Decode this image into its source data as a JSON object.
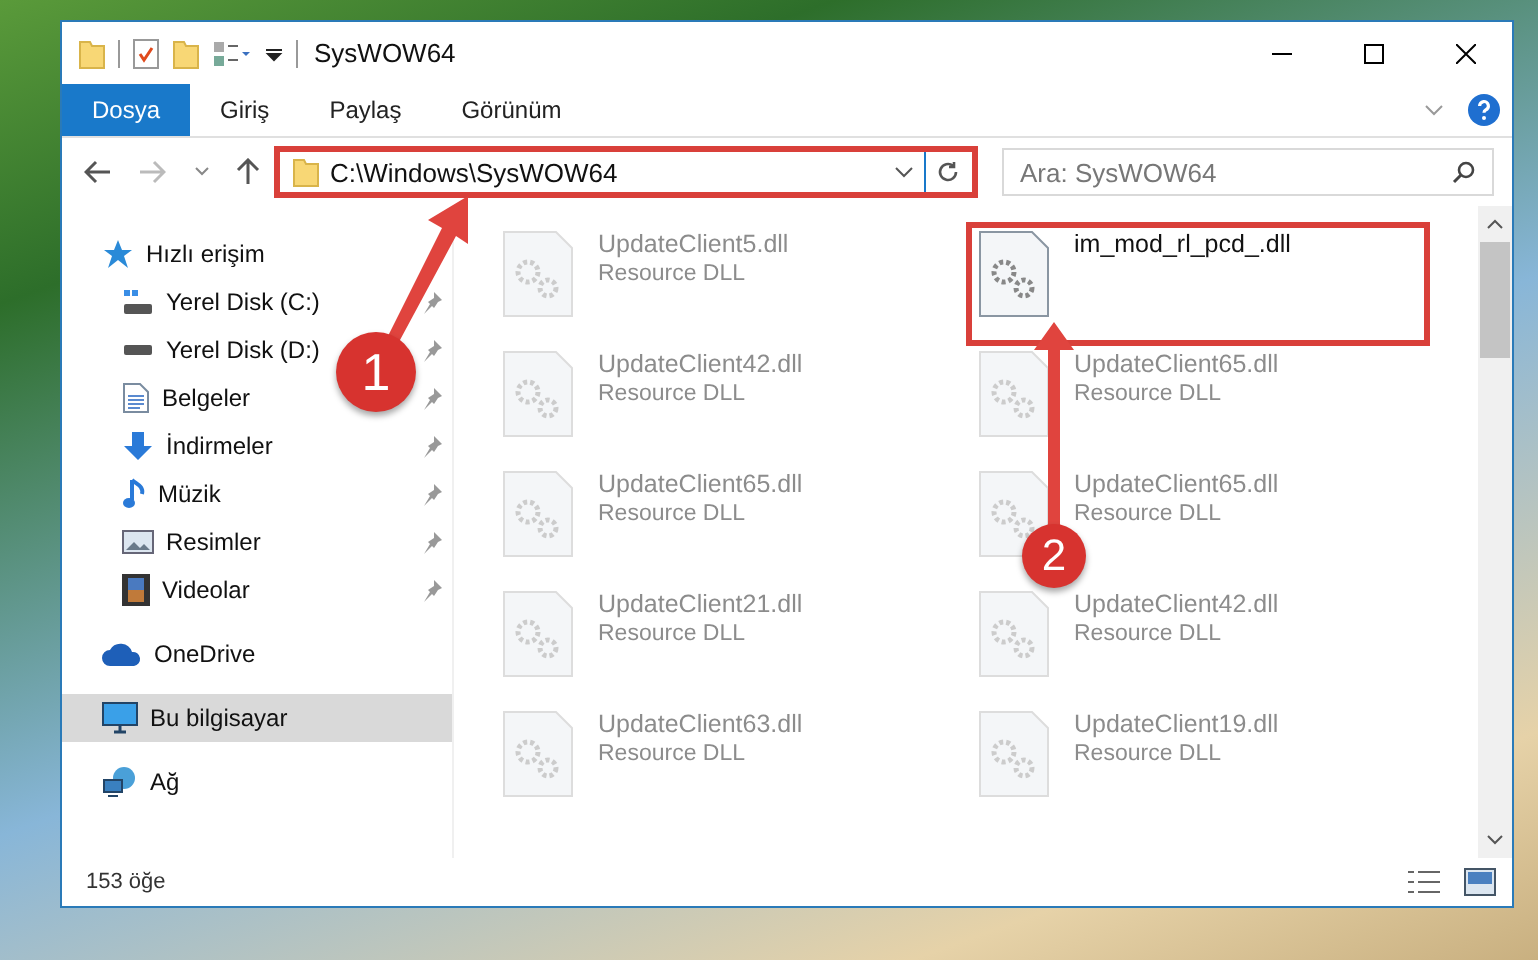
{
  "window": {
    "title": "SysWOW64"
  },
  "ribbon_tabs": [
    {
      "label": "Dosya",
      "selected": true
    },
    {
      "label": "Giriş",
      "selected": false
    },
    {
      "label": "Paylaş",
      "selected": false
    },
    {
      "label": "Görünüm",
      "selected": false
    }
  ],
  "address_bar": {
    "path": "C:\\Windows\\SysWOW64",
    "highlighted": true
  },
  "search": {
    "placeholder": "Ara: SysWOW64"
  },
  "nav_pane": [
    {
      "label": "Hızlı erişim",
      "kind": "star",
      "selected": false,
      "children": [
        {
          "label": "Yerel Disk (C:)",
          "kind": "sysdrive",
          "pinned": true
        },
        {
          "label": "Yerel Disk (D:)",
          "kind": "drive",
          "pinned": true
        },
        {
          "label": "Belgeler",
          "kind": "document",
          "pinned": true
        },
        {
          "label": "İndirmeler",
          "kind": "download",
          "pinned": true
        },
        {
          "label": "Müzik",
          "kind": "music",
          "pinned": true
        },
        {
          "label": "Resimler",
          "kind": "pictures",
          "pinned": true
        },
        {
          "label": "Videolar",
          "kind": "videos",
          "pinned": true
        }
      ]
    },
    {
      "label": "OneDrive",
      "kind": "cloud",
      "selected": false
    },
    {
      "label": "Bu bilgisayar",
      "kind": "computer",
      "selected": true
    },
    {
      "label": "Ağ",
      "kind": "network",
      "selected": false
    }
  ],
  "files": [
    {
      "name": "UpdateClient5.dll",
      "type": "Resource DLL",
      "dimmed": true,
      "highlighted": false
    },
    {
      "name": "im_mod_rl_pcd_.dll",
      "dimmed": false,
      "highlighted": true
    },
    {
      "name": "UpdateClient42.dll",
      "type": "Resource DLL",
      "dimmed": true,
      "highlighted": false
    },
    {
      "name": "UpdateClient65.dll",
      "type": "Resource DLL",
      "dimmed": true,
      "highlighted": false
    },
    {
      "name": "UpdateClient65.dll",
      "type": "Resource DLL",
      "dimmed": true,
      "highlighted": false
    },
    {
      "name": "UpdateClient65.dll",
      "type": "Resource DLL",
      "dimmed": true,
      "highlighted": false
    },
    {
      "name": "UpdateClient21.dll",
      "type": "Resource DLL",
      "dimmed": true,
      "highlighted": false
    },
    {
      "name": "UpdateClient42.dll",
      "type": "Resource DLL",
      "dimmed": true,
      "highlighted": false
    },
    {
      "name": "UpdateClient63.dll",
      "type": "Resource DLL",
      "dimmed": true,
      "highlighted": false
    },
    {
      "name": "UpdateClient19.dll",
      "type": "Resource DLL",
      "dimmed": true,
      "highlighted": false
    }
  ],
  "status_bar": {
    "item_count": "153 öğe"
  },
  "callouts": [
    {
      "number": "1"
    },
    {
      "number": "2"
    }
  ]
}
